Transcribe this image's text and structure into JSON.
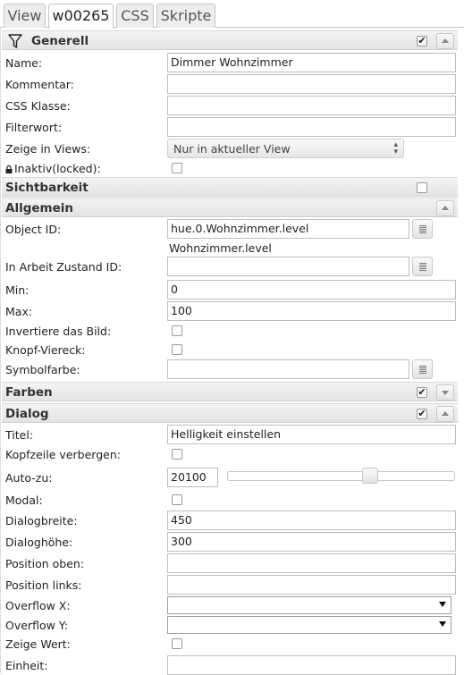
{
  "tabs": [
    "View",
    "w00265",
    "CSS",
    "Skripte"
  ],
  "active_tab": "w00265",
  "sections": {
    "generell": {
      "title": "Generell",
      "enabled": true
    },
    "sichtbarkeit": {
      "title": "Sichtbarkeit",
      "enabled": false
    },
    "allgemein": {
      "title": "Allgemein"
    },
    "farben": {
      "title": "Farben",
      "enabled": true
    },
    "dialog": {
      "title": "Dialog",
      "enabled": true
    }
  },
  "generell": {
    "name_label": "Name:",
    "name_value": "Dimmer Wohnzimmer",
    "kommentar_label": "Kommentar:",
    "kommentar_value": "",
    "css_klasse_label": "CSS Klasse:",
    "css_klasse_value": "",
    "filterwort_label": "Filterwort:",
    "filterwort_value": "",
    "zeige_views_label": "Zeige in Views:",
    "zeige_views_value": "Nur in aktueller View",
    "inaktiv_label": "Inaktiv(locked):",
    "inaktiv_checked": false
  },
  "allgemein": {
    "object_id_label": "Object ID:",
    "object_id_value": "hue.0.Wohnzimmer.level",
    "object_id_name": "Wohnzimmer.level",
    "arbeit_label": "In Arbeit Zustand ID:",
    "arbeit_value": "",
    "min_label": "Min:",
    "min_value": "0",
    "max_label": "Max:",
    "max_value": "100",
    "invertiere_label": "Invertiere das Bild:",
    "invertiere_checked": false,
    "knopf_label": "Knopf-Viereck:",
    "knopf_checked": false,
    "symbolfarbe_label": "Symbolfarbe:",
    "symbolfarbe_value": ""
  },
  "dialog": {
    "titel_label": "Titel:",
    "titel_value": "Helligkeit einstellen",
    "kopfzeile_label": "Kopfzeile verbergen:",
    "kopfzeile_checked": false,
    "autozu_label": "Auto-zu:",
    "autozu_value": "20100",
    "autozu_slider_fraction": 0.64,
    "modal_label": "Modal:",
    "modal_checked": false,
    "breite_label": "Dialogbreite:",
    "breite_value": "450",
    "hoehe_label": "Dialoghöhe:",
    "hoehe_value": "300",
    "pos_oben_label": "Position oben:",
    "pos_oben_value": "",
    "pos_links_label": "Position links:",
    "pos_links_value": "",
    "overflow_x_label": "Overflow X:",
    "overflow_x_value": "",
    "overflow_y_label": "Overflow Y:",
    "overflow_y_value": "",
    "zeige_wert_label": "Zeige Wert:",
    "zeige_wert_checked": false,
    "einheit_label": "Einheit:",
    "einheit_value": ""
  },
  "icons": {
    "filter": "filter-icon",
    "collapse": "chevron-up-icon",
    "expand": "chevron-down-icon",
    "picker": "list-picker-icon",
    "lock": "lock-icon"
  }
}
